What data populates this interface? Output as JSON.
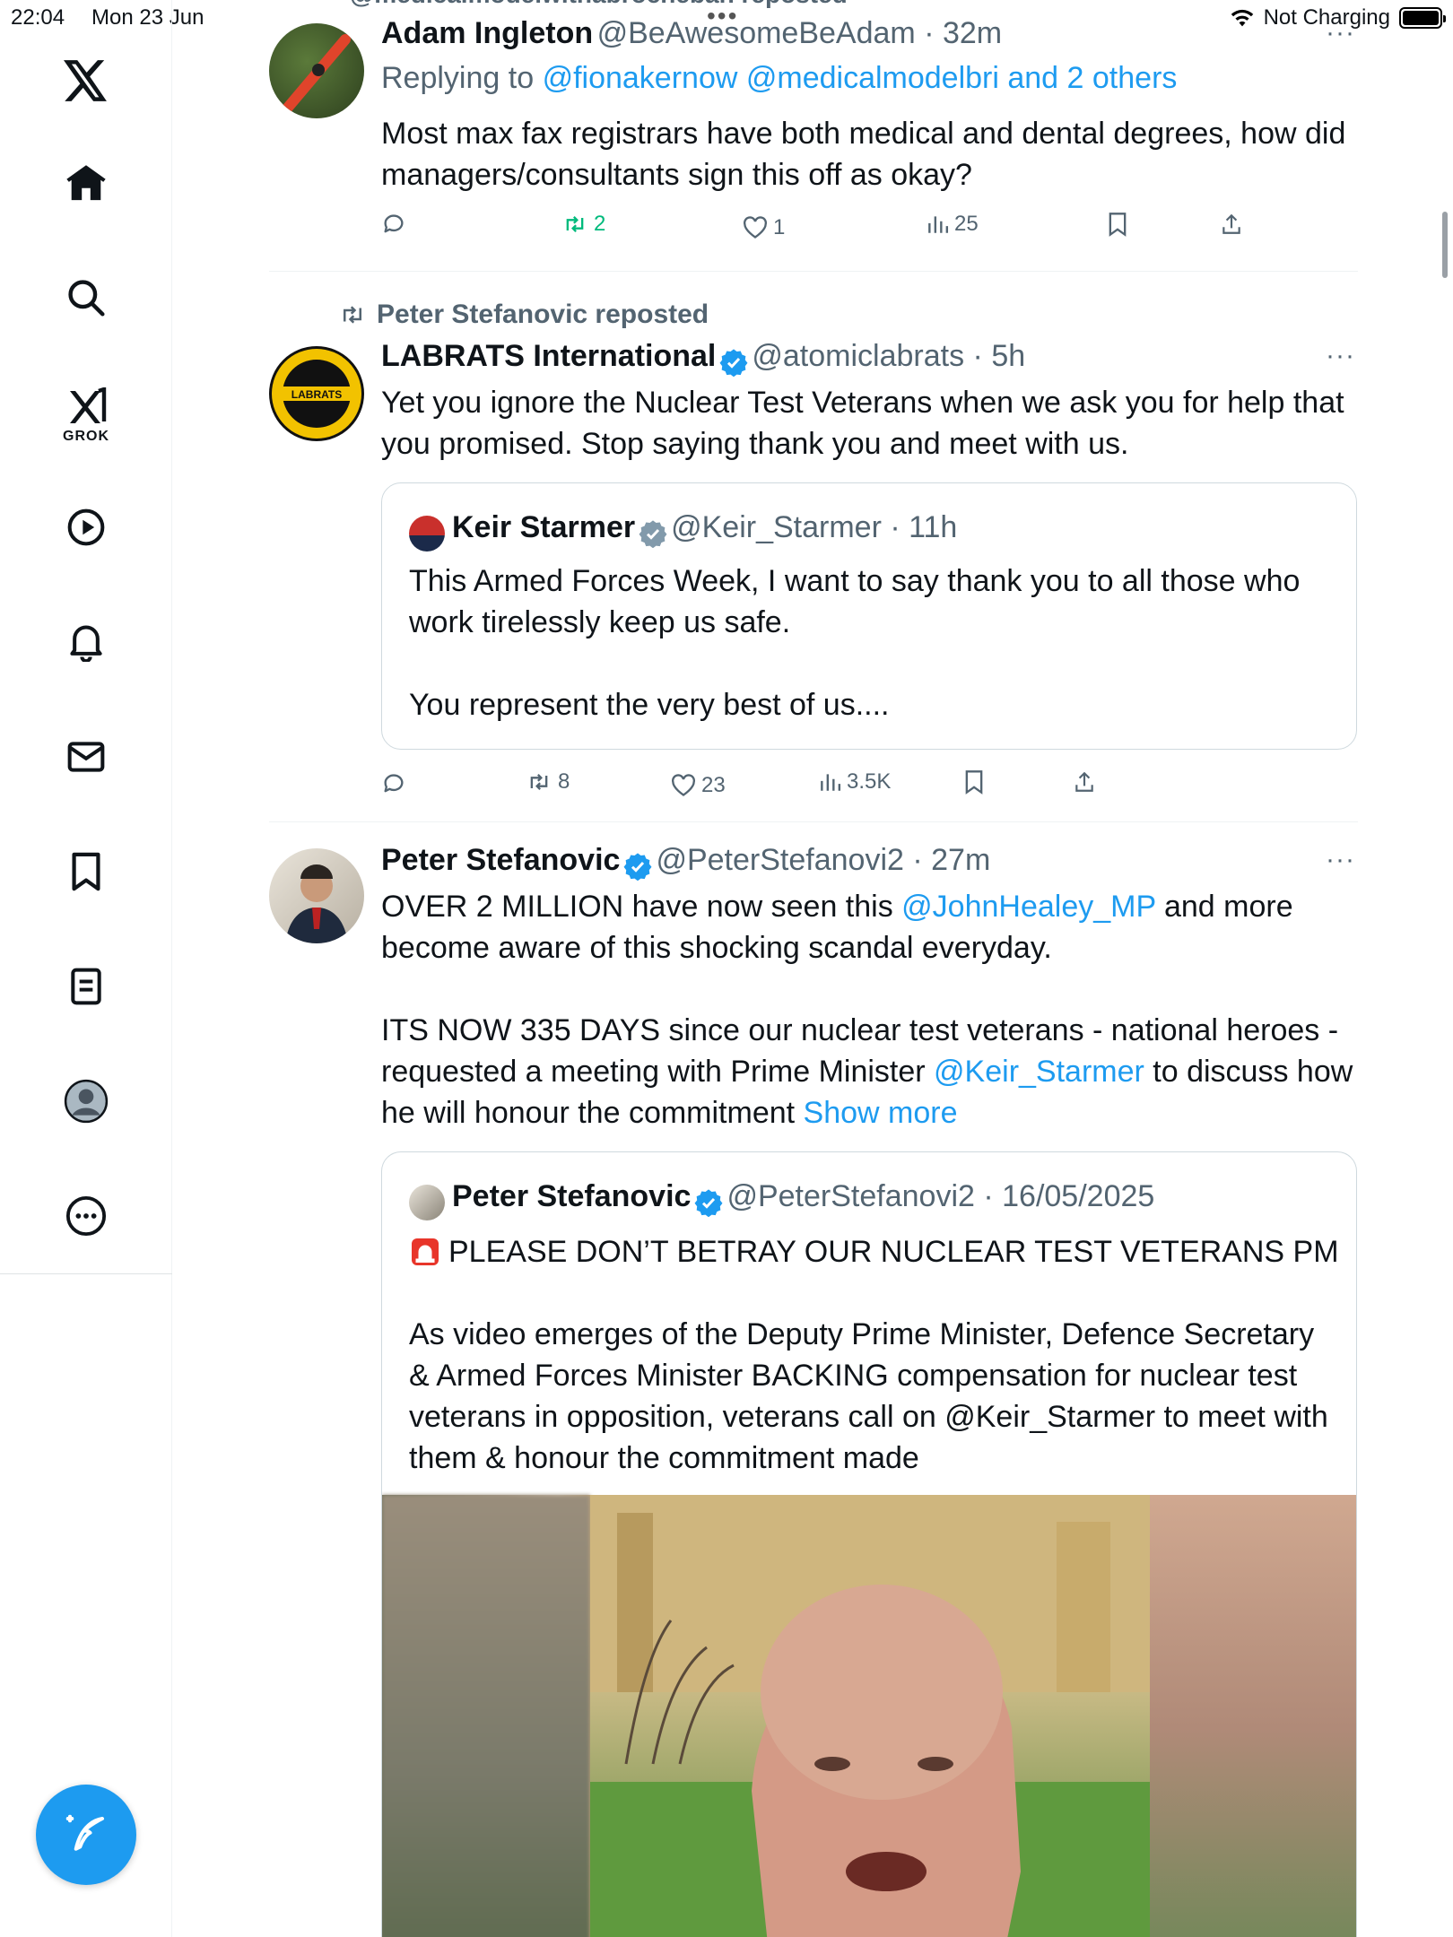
{
  "status_bar": {
    "time": "22:04",
    "date": "Mon 23 Jun",
    "charging": "Not Charging"
  },
  "sidebar": {
    "grok_label": "GROK"
  },
  "top_partial": {
    "text": "@medicalmodelwithabrocheban reposted"
  },
  "tweet1": {
    "name": "Adam Ingleton",
    "handle": "@BeAwesomeBeAdam",
    "time": "32m",
    "replying_prefix": "Replying to",
    "replying_targets": "@fionakernow @medicalmodelbri and 2 others",
    "text_line1": "Most max fax registrars have both medical and dental degrees, how did",
    "text_line2": "managers/consultants sign this off as okay?",
    "retweets": "2",
    "likes": "1",
    "views": "25"
  },
  "tweet2": {
    "repost_label": "Peter Stefanovic reposted",
    "name": "LABRATS International",
    "handle": "@atomiclabrats",
    "time": "5h",
    "text_line1": "Yet you ignore the Nuclear Test Veterans when we ask you for help that",
    "text_line2": "you promised. Stop saying thank you and meet with us.",
    "avatar_text": "LABRATS",
    "quote": {
      "name": "Keir Starmer",
      "handle": "@Keir_Starmer",
      "time": "11h",
      "line1": "This Armed Forces Week, I want to say thank you to all those who",
      "line2": "work tirelessly keep us safe.",
      "line3": "You represent the very best of us...."
    },
    "retweets": "8",
    "likes": "23",
    "views": "3.5K"
  },
  "tweet3": {
    "name": "Peter Stefanovic",
    "handle": "@PeterStefanovi2",
    "time": "27m",
    "p1_a": "OVER 2 MILLION have now seen this ",
    "p1_link": "@JohnHealey_MP",
    "p1_b": " and more",
    "p1_line2": "become aware of this shocking scandal everyday.",
    "p2_line1": "ITS NOW 335 DAYS since our nuclear test veterans - national heroes -",
    "p2_a": "requested a meeting with Prime Minister ",
    "p2_link": "@Keir_Starmer",
    "p2_b": " to discuss how",
    "p2_line3": "he will honour the commitment ",
    "show_more": "Show more",
    "quote": {
      "name": "Peter Stefanovic",
      "handle": "@PeterStefanovi2",
      "date": "16/05/2025",
      "headline": "PLEASE DON’T BETRAY OUR NUCLEAR TEST VETERANS PM",
      "line1": "As video emerges of the Deputy Prime Minister, Defence Secretary",
      "line2": "& Armed Forces Minister BACKING compensation for nuclear test",
      "line3": "veterans in opposition, veterans call on @Keir_Starmer to meet with",
      "line4": "them & honour the commitment made"
    }
  },
  "colors": {
    "accent": "#1d9bf0",
    "retweet_active": "#00ba7c",
    "secondary_text": "#536471",
    "border": "#cfd9de"
  }
}
